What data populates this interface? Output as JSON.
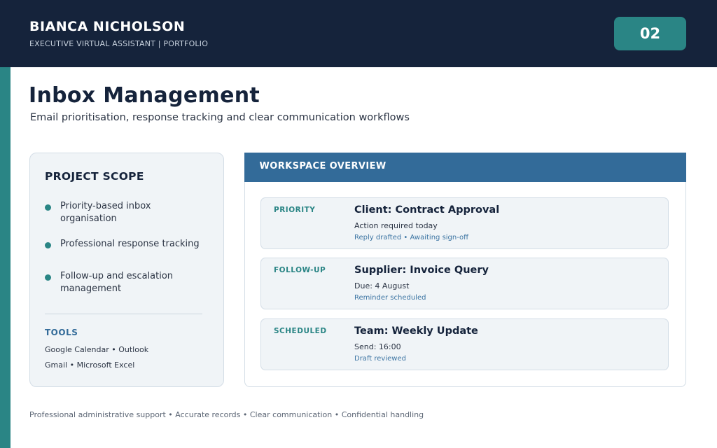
{
  "header": {
    "name": "BIANCA NICHOLSON",
    "role": "EXECUTIVE VIRTUAL ASSISTANT | PORTFOLIO",
    "page_number": "02"
  },
  "page": {
    "title": "Inbox Management",
    "subtitle": "Email prioritisation, response tracking and clear communication workflows"
  },
  "scope": {
    "heading": "PROJECT SCOPE",
    "items": [
      "Priority-based inbox organisation",
      "Professional response tracking",
      "Follow-up and escalation management"
    ],
    "tools_heading": "TOOLS",
    "tools_lines": [
      "Google Calendar • Outlook",
      "Gmail • Microsoft Excel"
    ]
  },
  "overview": {
    "title": "WORKSPACE OVERVIEW",
    "emails": [
      {
        "tag": "PRIORITY",
        "subject": "Client: Contract Approval",
        "detail": "Action required today",
        "status": "Reply drafted • Awaiting sign-off"
      },
      {
        "tag": "FOLLOW-UP",
        "subject": "Supplier: Invoice Query",
        "detail": "Due: 4 August",
        "status": "Reminder scheduled"
      },
      {
        "tag": "SCHEDULED",
        "subject": "Team: Weekly Update",
        "detail": "Send: 16:00",
        "status": "Draft reviewed"
      }
    ]
  },
  "footer": {
    "text": "Professional administrative support • Accurate records • Clear communication • Confidential handling"
  },
  "colors": {
    "navy": "#15233b",
    "teal": "#2a8585",
    "blue": "#336b99",
    "card_bg": "#f0f4f7"
  }
}
